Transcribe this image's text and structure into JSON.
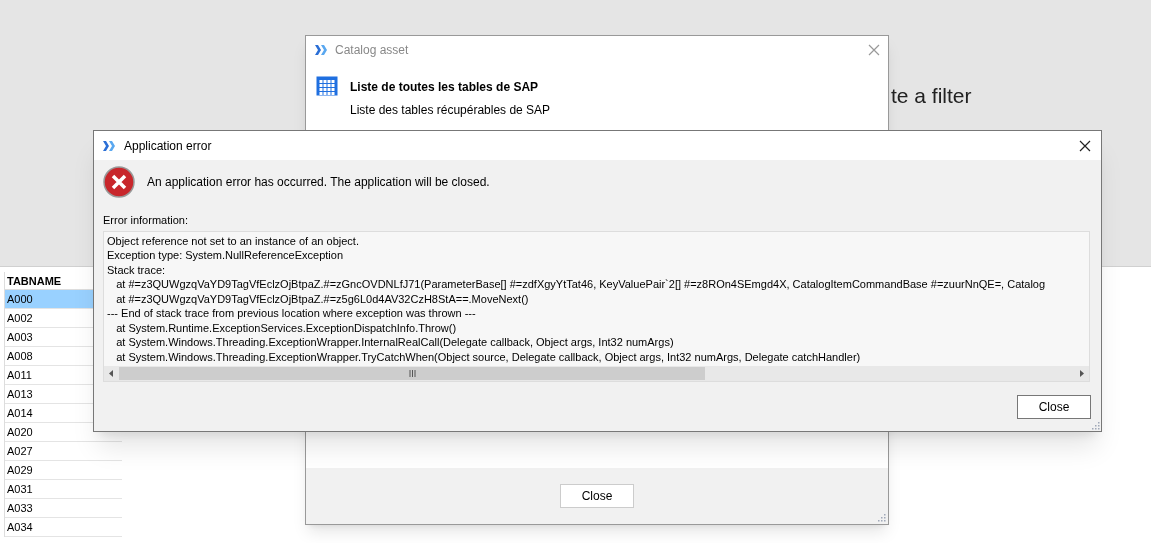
{
  "background": {
    "filter_hint": "te a filter"
  },
  "table": {
    "column": "TABNAME",
    "rows": [
      {
        "name": "A000",
        "selected": true
      },
      {
        "name": "A002",
        "selected": false
      },
      {
        "name": "A003",
        "selected": false
      },
      {
        "name": "A008",
        "selected": false
      },
      {
        "name": "A011",
        "selected": false
      },
      {
        "name": "A013",
        "selected": false
      },
      {
        "name": "A014",
        "selected": false
      },
      {
        "name": "A020",
        "selected": false
      },
      {
        "name": "A027",
        "selected": false
      },
      {
        "name": "A029",
        "selected": false
      },
      {
        "name": "A031",
        "selected": false
      },
      {
        "name": "A033",
        "selected": false
      },
      {
        "name": "A034",
        "selected": false
      }
    ]
  },
  "catalog_dialog": {
    "title": "Catalog asset",
    "heading": "Liste de toutes les tables de SAP",
    "subheading": "Liste des tables récupérables de SAP",
    "close_button": "Close"
  },
  "error_dialog": {
    "title": "Application error",
    "message": "An application error has occurred. The application will be closed.",
    "details_label": "Error information:",
    "details": [
      "Object reference not set to an instance of an object.",
      "Exception type: System.NullReferenceException",
      "Stack trace:",
      "   at #=z3QUWgzqVaYD9TagVfEclzOjBtpaZ.#=zGncOVDNLfJ71(ParameterBase[] #=zdfXgyYtTat46, KeyValuePair`2[] #=z8ROn4SEmgd4X, CatalogItemCommandBase #=zuurNnQE=, Catalog",
      "   at #=z3QUWgzqVaYD9TagVfEclzOjBtpaZ.#=z5g6L0d4AV32CzH8StA==.MoveNext()",
      "--- End of stack trace from previous location where exception was thrown ---",
      "   at System.Runtime.ExceptionServices.ExceptionDispatchInfo.Throw()",
      "   at System.Windows.Threading.ExceptionWrapper.InternalRealCall(Delegate callback, Object args, Int32 numArgs)",
      "   at System.Windows.Threading.ExceptionWrapper.TryCatchWhen(Object source, Delegate callback, Object args, Int32 numArgs, Delegate catchHandler)"
    ],
    "close_button": "Close"
  }
}
